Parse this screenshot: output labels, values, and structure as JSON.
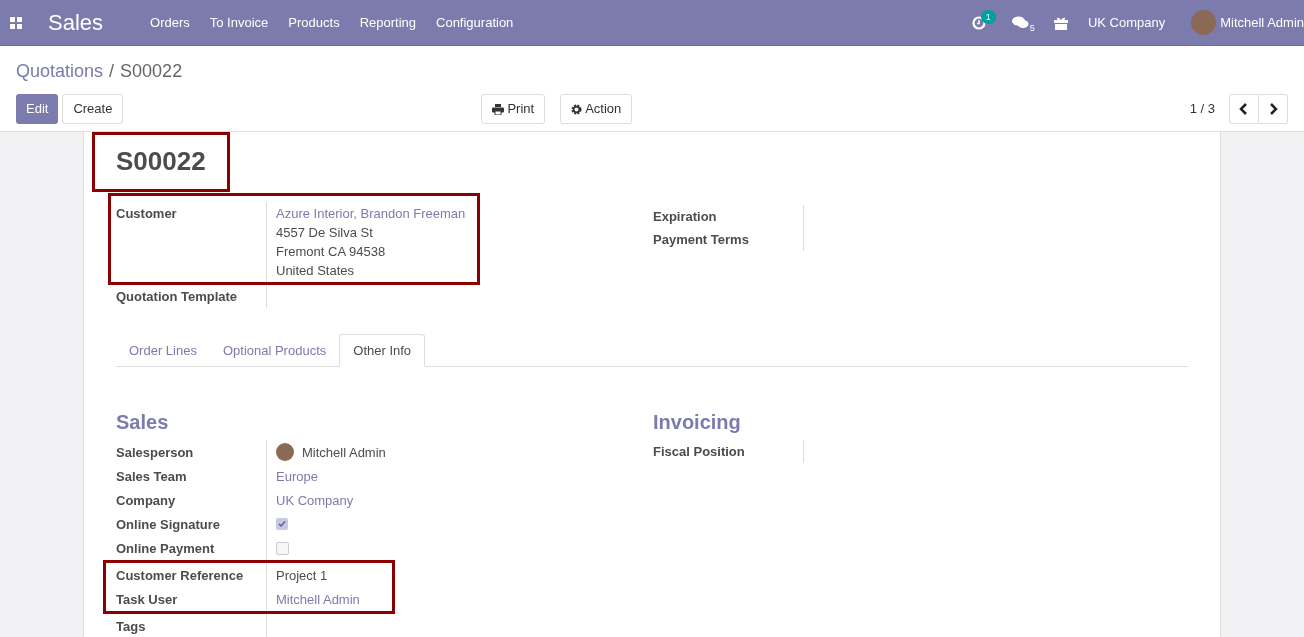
{
  "navbar": {
    "app": "Sales",
    "menu": [
      "Orders",
      "To Invoice",
      "Products",
      "Reporting",
      "Configuration"
    ],
    "activity_count": "1",
    "message_count": "5",
    "company": "UK Company",
    "user": "Mitchell Admin"
  },
  "breadcrumb": {
    "parent": "Quotations",
    "separator": "/",
    "current": "S00022"
  },
  "buttons": {
    "edit": "Edit",
    "create": "Create",
    "print": "Print",
    "action": "Action"
  },
  "pager": "1 / 3",
  "record": {
    "title": "S00022",
    "highlighted": true
  },
  "header_left": [
    {
      "label": "Customer",
      "kind": "address",
      "link": "Azure Interior, Brandon Freeman",
      "lines": [
        "4557 De Silva St",
        "Fremont CA 94538",
        "United States"
      ],
      "highlighted": true
    },
    {
      "label": "Quotation Template",
      "kind": "empty",
      "highlighted": false
    }
  ],
  "header_right": [
    {
      "label": "Expiration"
    },
    {
      "label": "Payment Terms"
    }
  ],
  "tabs": [
    {
      "label": "Order Lines",
      "selected": false
    },
    {
      "label": "Optional Products",
      "selected": false
    },
    {
      "label": "Other Info",
      "selected": true
    }
  ],
  "sales": {
    "title": "Sales",
    "fields": [
      {
        "label": "Salesperson",
        "kind": "user",
        "value": "Mitchell Admin",
        "highlighted": false
      },
      {
        "label": "Sales Team",
        "kind": "link",
        "value": "Europe",
        "highlighted": false
      },
      {
        "label": "Company",
        "kind": "link",
        "value": "UK Company",
        "highlighted": false
      },
      {
        "label": "Online Signature",
        "kind": "checkbox",
        "checked": true,
        "highlighted": false
      },
      {
        "label": "Online Payment",
        "kind": "checkbox",
        "checked": false,
        "highlighted": false
      },
      {
        "label": "Customer Reference",
        "kind": "text",
        "value": "Project 1",
        "highlighted": true
      },
      {
        "label": "Task User",
        "kind": "link",
        "value": "Mitchell Admin",
        "highlighted": true
      },
      {
        "label": "Tags",
        "kind": "empty",
        "highlighted": false
      }
    ]
  },
  "invoicing": {
    "title": "Invoicing",
    "fields": [
      {
        "label": "Fiscal Position"
      }
    ]
  }
}
